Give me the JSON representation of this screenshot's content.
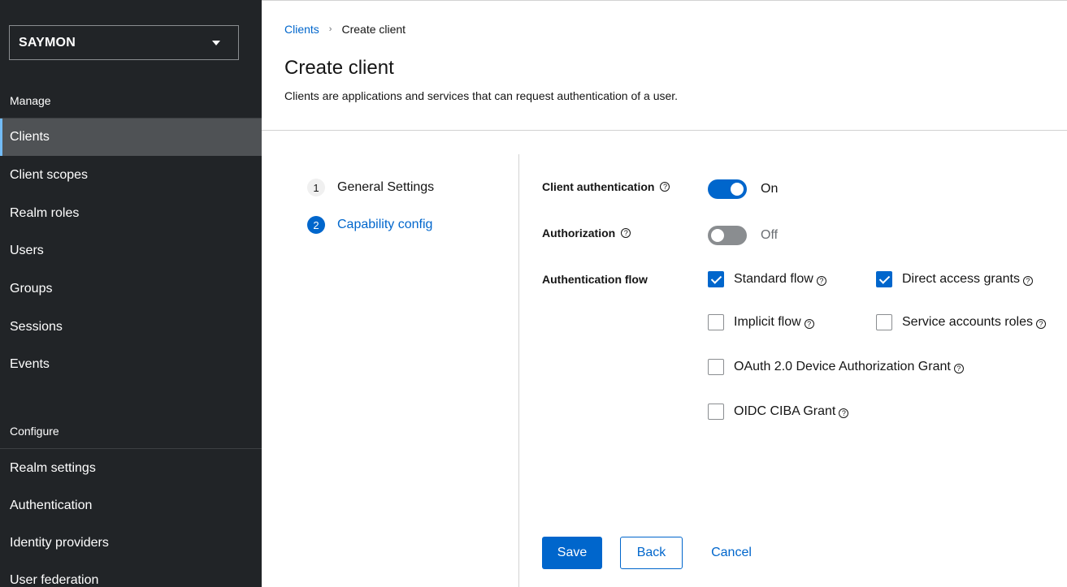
{
  "sidebar": {
    "realm": "SAYMON",
    "manage_label": "Manage",
    "manage_items": [
      {
        "label": "Clients",
        "active": true
      },
      {
        "label": "Client scopes"
      },
      {
        "label": "Realm roles"
      },
      {
        "label": "Users"
      },
      {
        "label": "Groups"
      },
      {
        "label": "Sessions"
      },
      {
        "label": "Events"
      }
    ],
    "configure_label": "Configure",
    "configure_items": [
      {
        "label": "Realm settings"
      },
      {
        "label": "Authentication"
      },
      {
        "label": "Identity providers"
      },
      {
        "label": "User federation"
      }
    ]
  },
  "breadcrumb": {
    "parent": "Clients",
    "separator": "›",
    "current": "Create client"
  },
  "header": {
    "title": "Create client",
    "description": "Clients are applications and services that can request authentication of a user."
  },
  "wizard": {
    "steps": [
      {
        "number": "1",
        "label": "General Settings",
        "active": false
      },
      {
        "number": "2",
        "label": "Capability config",
        "active": true
      }
    ]
  },
  "form": {
    "help_glyph": "?",
    "client_authentication": {
      "label": "Client authentication",
      "state_text": "On",
      "enabled": true
    },
    "authorization": {
      "label": "Authorization",
      "state_text": "Off",
      "enabled": false
    },
    "authentication_flow": {
      "label": "Authentication flow",
      "options": [
        {
          "label": "Standard flow",
          "checked": true
        },
        {
          "label": "Direct access grants",
          "checked": true
        },
        {
          "label": "Implicit flow",
          "checked": false
        },
        {
          "label": "Service accounts roles",
          "checked": false
        },
        {
          "label": "OAuth 2.0 Device Authorization Grant",
          "checked": false
        },
        {
          "label": "OIDC CIBA Grant",
          "checked": false
        }
      ]
    }
  },
  "actions": {
    "save": "Save",
    "back": "Back",
    "cancel": "Cancel"
  },
  "colors": {
    "sidebar_bg": "#212427",
    "active_nav_bg": "#4f5255",
    "active_nav_accent": "#73bcf7",
    "primary": "#0066cc",
    "switch_off": "#8a8d90"
  },
  "icons": {
    "realm_dropdown": "caret-down-icon",
    "breadcrumb_separator": "chevron-right-icon",
    "help": "help-circle-icon",
    "checkbox_check": "check-icon"
  }
}
